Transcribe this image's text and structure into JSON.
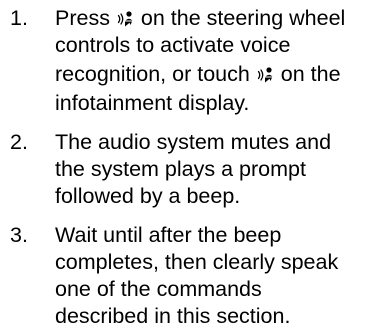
{
  "steps": [
    {
      "number": "1.",
      "line1_before_icon": "Press ",
      "icon1": "voice-recognition-icon",
      "line1_after_icon": " on the steering wheel",
      "line2": "controls to activate voice",
      "line3_before_icon": "recognition, or touch ",
      "icon2": "voice-recognition-icon",
      "line3_after_icon": " on the",
      "line4": "infotainment display."
    },
    {
      "number": "2.",
      "lines": [
        "The audio system mutes and",
        "the system plays a prompt",
        "followed by a beep."
      ]
    },
    {
      "number": "3.",
      "lines": [
        "Wait until after the beep",
        "completes, then clearly speak",
        "one of the commands",
        "described in this section."
      ]
    }
  ]
}
